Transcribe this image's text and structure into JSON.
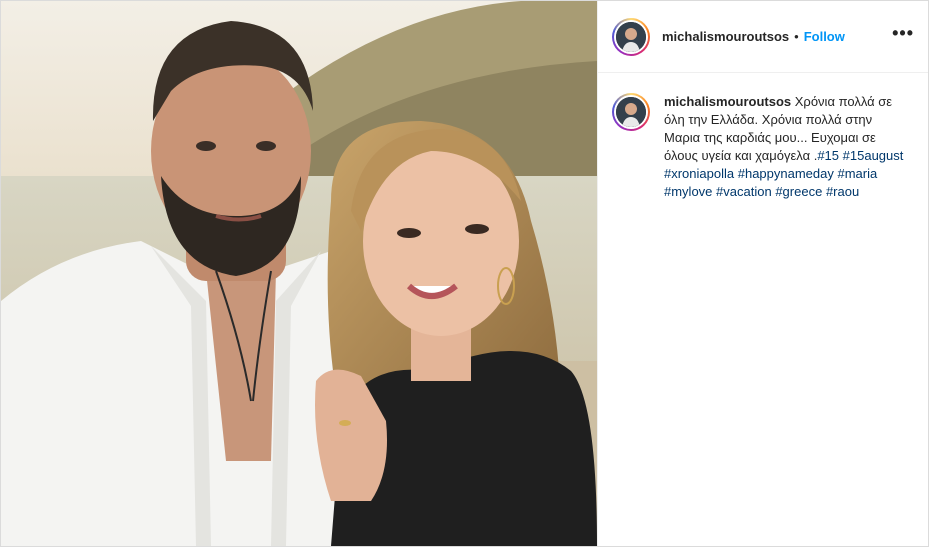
{
  "post": {
    "username": "michalismouroutsos",
    "dot": "•",
    "follow_label": "Follow",
    "more_label": "•••",
    "caption": {
      "username": "michalismouroutsos",
      "text": "Χρόνια πολλά σε όλη την Ελλάδα. Χρόνια πολλά στην Μαρια της καρδιάς μου... Ευχομαι σε όλους υγεία και χαμόγελα .",
      "hashtags": [
        "#15",
        "#15august",
        "#xroniapolla",
        "#happynameday",
        "#maria",
        "#mylove",
        "#vacation",
        "#greece",
        "#raou"
      ]
    }
  },
  "colors": {
    "follow": "#0095f6",
    "hashtag": "#00376b",
    "text": "#262626"
  }
}
